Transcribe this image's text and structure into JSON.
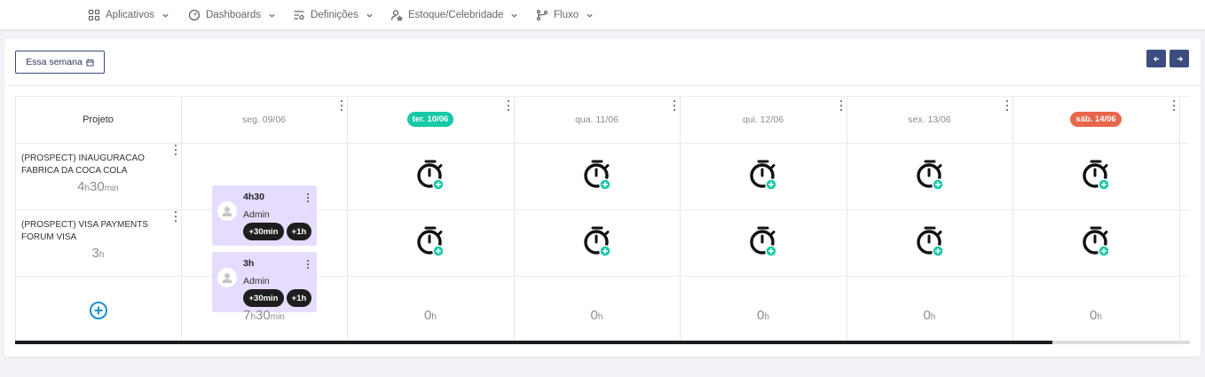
{
  "nav": {
    "items": [
      {
        "label": "Aplicativos",
        "icon": "apps-grid-icon"
      },
      {
        "label": "Dashboards",
        "icon": "dashboard-gauge-icon"
      },
      {
        "label": "Definições",
        "icon": "settings-sliders-icon"
      },
      {
        "label": "Estoque/Celebridade",
        "icon": "user-star-icon"
      },
      {
        "label": "Fluxo",
        "icon": "flow-branch-icon"
      }
    ]
  },
  "toolbar": {
    "week_label": "Essa semana",
    "prev_icon": "arrow-left-icon",
    "next_icon": "arrow-right-icon"
  },
  "grid": {
    "project_header": "Projeto",
    "days": [
      {
        "label": "seg. 09/06",
        "style": "plain"
      },
      {
        "label": "ter. 10/06",
        "style": "today"
      },
      {
        "label": "qua. 11/06",
        "style": "plain"
      },
      {
        "label": "qui. 12/06",
        "style": "plain"
      },
      {
        "label": "sex. 13/06",
        "style": "plain"
      },
      {
        "label": "sáb. 14/06",
        "style": "weekend"
      }
    ],
    "projects": [
      {
        "name": "(PROSPECT) INAUGURACAO FABRICA DA COCA COLA",
        "hours_num": "4",
        "hours_unit": "h",
        "min_num": "30",
        "min_unit": "min",
        "entry": {
          "duration": "4h30",
          "user": "Admin",
          "chip1": "+30min",
          "chip2": "+1h"
        }
      },
      {
        "name": "(PROSPECT) VISA PAYMENTS FORUM VISA",
        "hours_num": "3",
        "hours_unit": "h",
        "min_num": "",
        "min_unit": "",
        "entry": {
          "duration": "3h",
          "user": "Admin",
          "chip1": "+30min",
          "chip2": "+1h"
        }
      }
    ],
    "totals": [
      {
        "num": "7",
        "unit": "h",
        "min_num": "30",
        "min_unit": "min"
      },
      {
        "num": "0",
        "unit": "h"
      },
      {
        "num": "0",
        "unit": "h"
      },
      {
        "num": "0",
        "unit": "h"
      },
      {
        "num": "0",
        "unit": "h"
      },
      {
        "num": "0",
        "unit": "h"
      }
    ]
  },
  "colors": {
    "today_pill": "#17c9a7",
    "weekend_pill": "#e9654a",
    "entry_bg": "#e6dcff",
    "add_accent": "#17c9a7",
    "primary": "#3d4d80",
    "add_project": "#1a8fd6"
  }
}
